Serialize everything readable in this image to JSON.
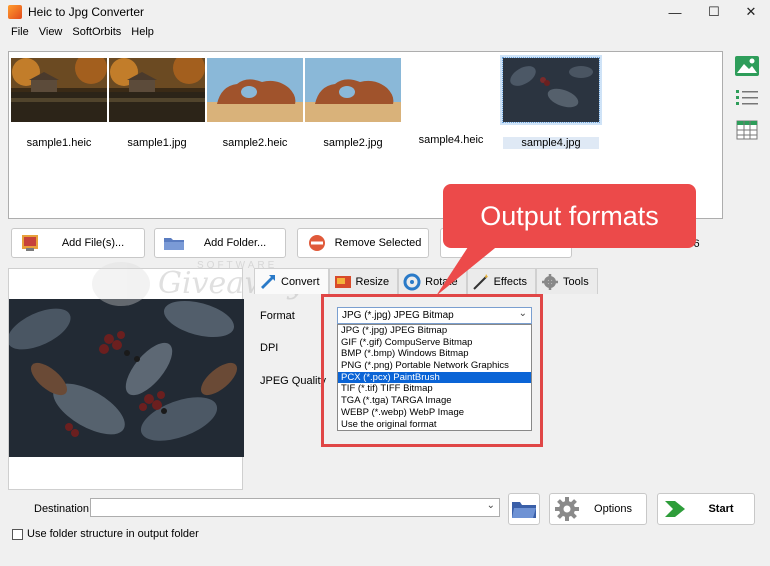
{
  "window": {
    "title": "Heic to Jpg Converter",
    "controls": {
      "minimize": "—",
      "maximize": "☐",
      "close": "✕"
    }
  },
  "menu": [
    "File",
    "View",
    "SoftOrbits",
    "Help"
  ],
  "thumbnails": [
    {
      "caption": "sample1.heic",
      "image": "autumn-lake-house"
    },
    {
      "caption": "sample1.jpg",
      "image": "autumn-lake-house"
    },
    {
      "caption": "sample2.heic",
      "image": "desert-arch"
    },
    {
      "caption": "sample2.jpg",
      "image": "desert-arch"
    },
    {
      "caption": "sample4.heic",
      "image": "blank"
    },
    {
      "caption": "sample4.jpg",
      "image": "dark-leaves",
      "selected": true
    }
  ],
  "side_view_icons": [
    "image-view-icon",
    "list-view-icon",
    "table-view-icon"
  ],
  "toolbar": {
    "add_files": "Add File(s)...",
    "add_folder": "Add Folder...",
    "remove_selected": "Remove Selected",
    "count_text": "Count: 6"
  },
  "tabs": [
    {
      "label": "Convert",
      "icon": "convert-icon",
      "active": true
    },
    {
      "label": "Resize",
      "icon": "resize-icon"
    },
    {
      "label": "Rotate",
      "icon": "rotate-icon"
    },
    {
      "label": "Effects",
      "icon": "effects-icon"
    },
    {
      "label": "Tools",
      "icon": "tools-icon"
    }
  ],
  "settings": {
    "format_label": "Format",
    "dpi_label": "DPI",
    "jpeg_quality_label": "JPEG Quality",
    "format_selected": "JPG (*.jpg) JPEG Bitmap",
    "format_options": [
      "JPG (*.jpg) JPEG Bitmap",
      "GIF (*.gif) CompuServe Bitmap",
      "BMP (*.bmp) Windows Bitmap",
      "PNG (*.png) Portable Network Graphics",
      "PCX (*.pcx) PaintBrush",
      "TIF (*.tif) TIFF Bitmap",
      "TGA (*.tga) TARGA Image",
      "WEBP (*.webp) WebP Image",
      "Use the original format"
    ],
    "highlighted_option_index": 4
  },
  "annotation": {
    "callout_text": "Output formats",
    "color": "#ec4a4a"
  },
  "watermark": {
    "top_text": "SOFTWARE",
    "main_text": "Giveaway"
  },
  "bottom": {
    "destination_label": "Destination",
    "destination_value": "",
    "options_label": "Options",
    "start_label": "Start",
    "folder_structure_label": "Use folder structure in output folder",
    "folder_structure_checked": false
  }
}
